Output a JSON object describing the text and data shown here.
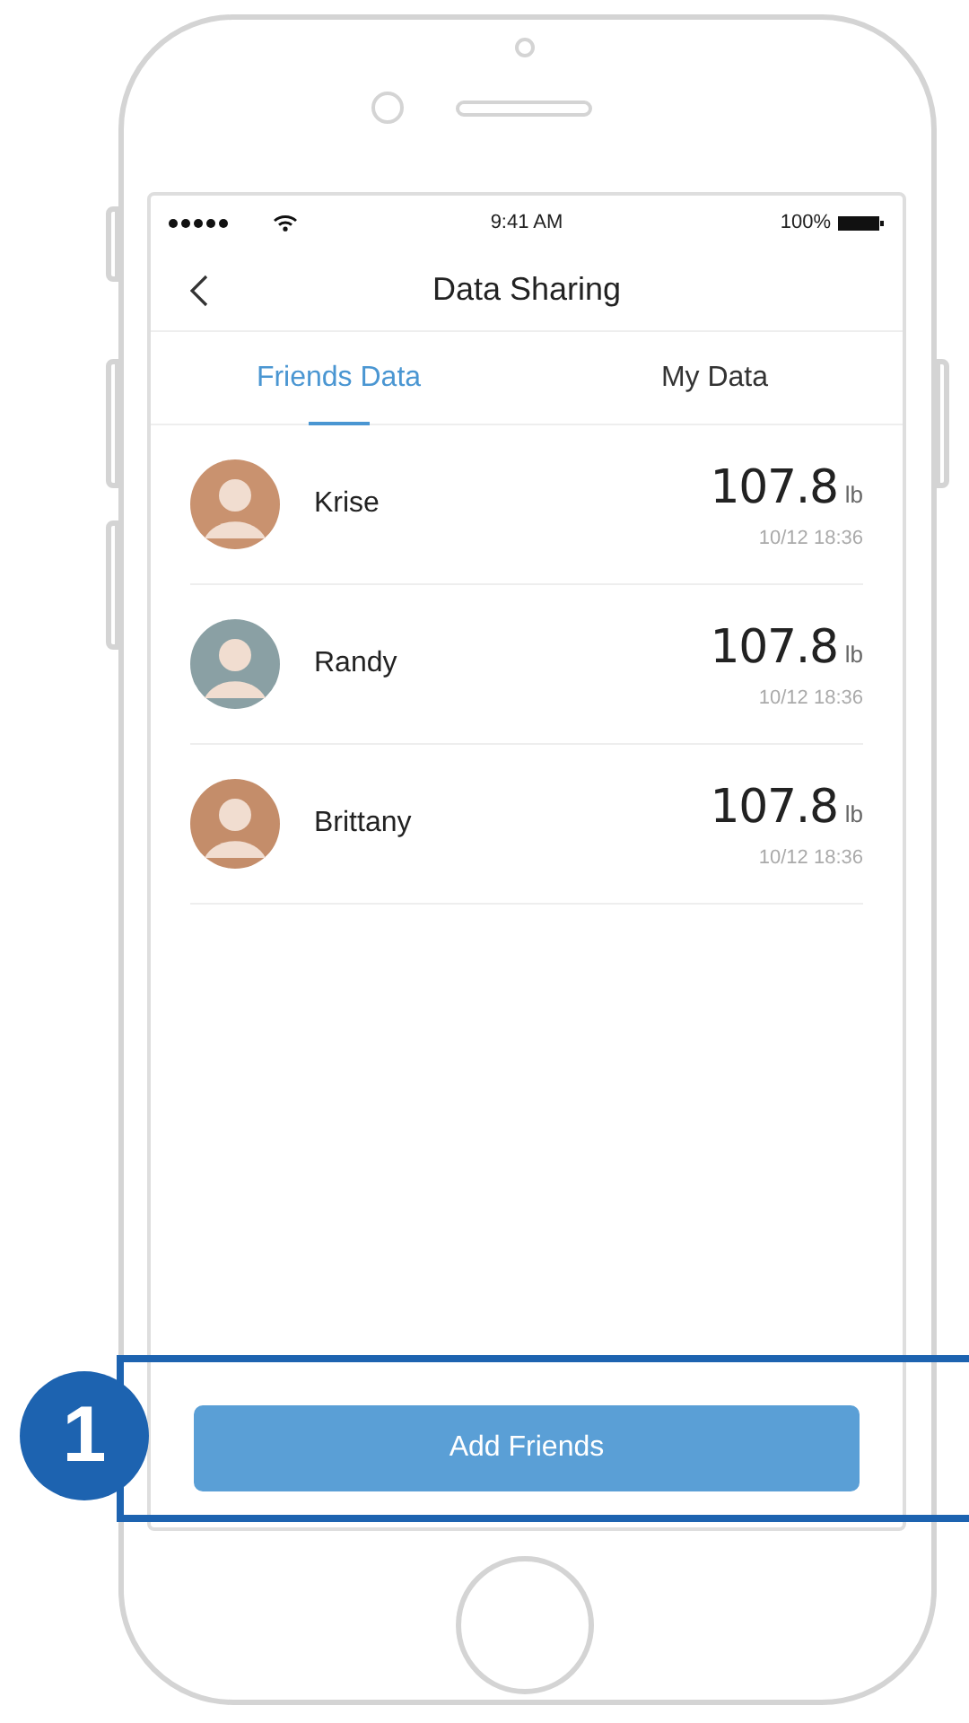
{
  "status_bar": {
    "time": "9:41 AM",
    "battery": "100%"
  },
  "nav": {
    "title": "Data Sharing"
  },
  "tabs": [
    {
      "label": "Friends Data",
      "selected": true
    },
    {
      "label": "My Data",
      "selected": false
    }
  ],
  "friends": [
    {
      "name": "Krise",
      "value": "107.8",
      "unit": "lb",
      "time": "10/12 18:36"
    },
    {
      "name": "Randy",
      "value": "107.8",
      "unit": "lb",
      "time": "10/12 18:36"
    },
    {
      "name": "Brittany",
      "value": "107.8",
      "unit": "lb",
      "time": "10/12 18:36"
    }
  ],
  "button": {
    "label": "Add Friends"
  },
  "callout": {
    "number": "1"
  }
}
